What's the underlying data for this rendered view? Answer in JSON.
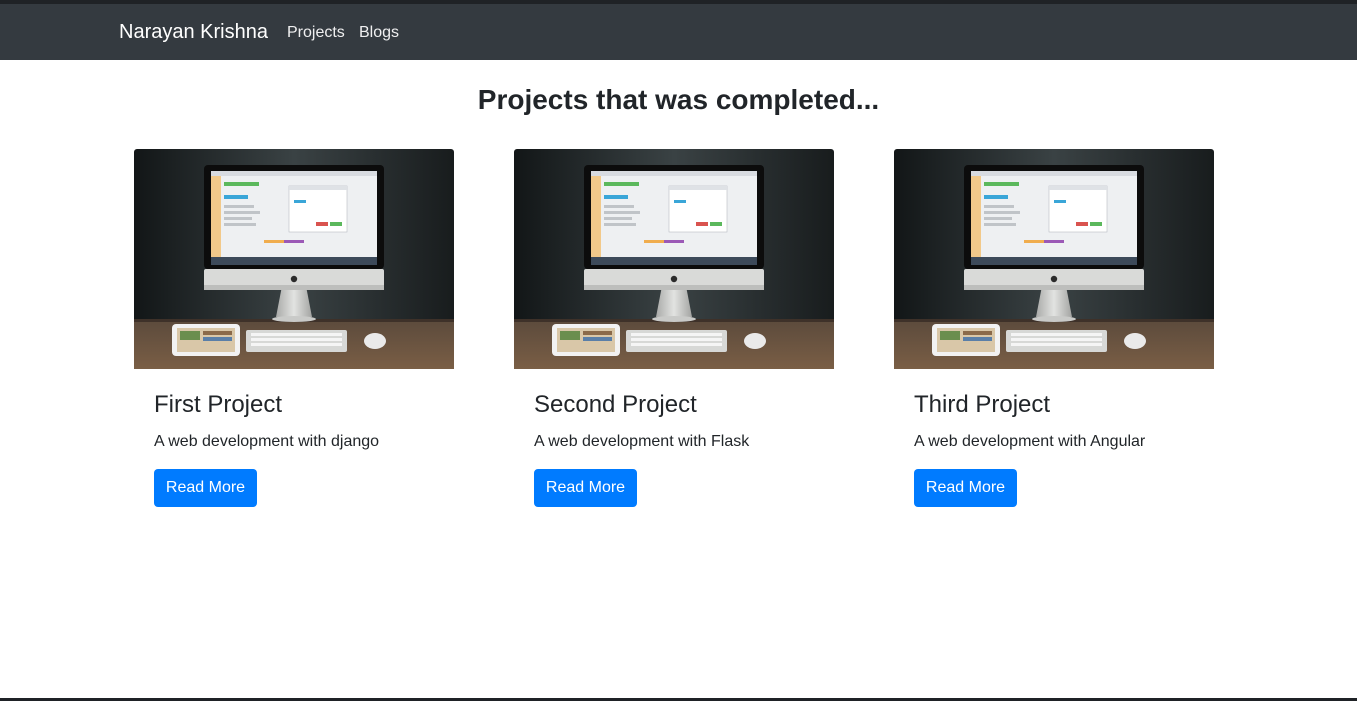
{
  "navbar": {
    "brand": "Narayan Krishna",
    "links": [
      {
        "label": "Projects"
      },
      {
        "label": "Blogs"
      }
    ]
  },
  "main": {
    "title": "Projects that was completed...",
    "cards": [
      {
        "title": "First Project",
        "text": "A web development with django",
        "button": "Read More",
        "image": "imac-desk-photo"
      },
      {
        "title": "Second Project",
        "text": "A web development with Flask",
        "button": "Read More",
        "image": "imac-desk-photo"
      },
      {
        "title": "Third Project",
        "text": "A web development with Angular",
        "button": "Read More",
        "image": "imac-desk-photo"
      }
    ]
  },
  "colors": {
    "navbar_bg": "#343a40",
    "button_primary": "#007bff",
    "text": "#212529"
  }
}
